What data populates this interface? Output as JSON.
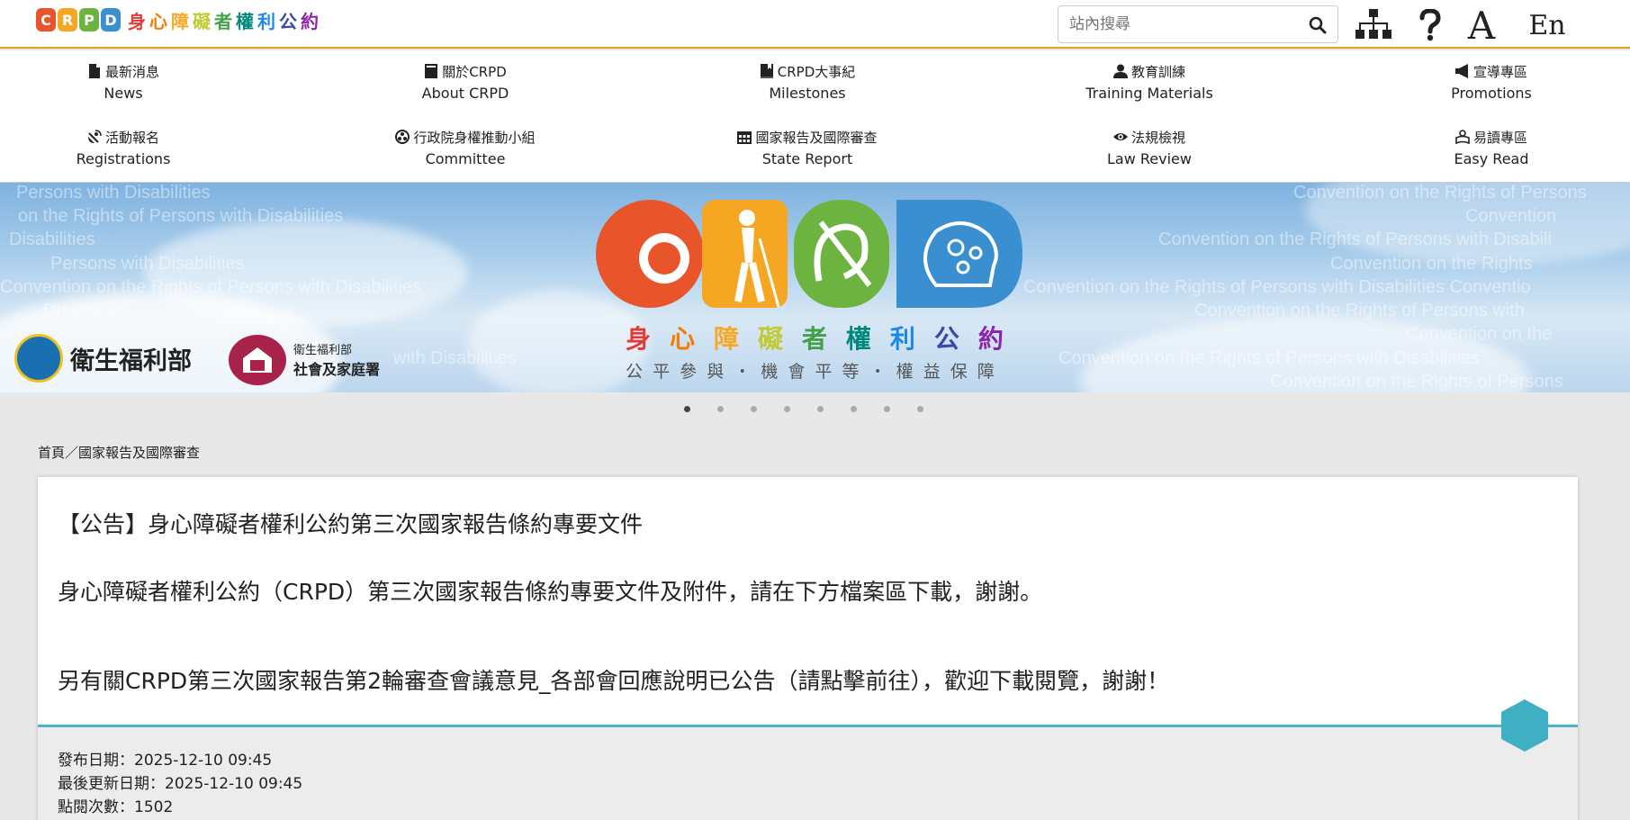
{
  "header": {
    "logo_text": [
      "身",
      "心",
      "障",
      "礙",
      "者",
      "權",
      "利",
      "公",
      "約"
    ],
    "logo_letters": [
      "C",
      "R",
      "P",
      "D"
    ],
    "search_placeholder": "站內搜尋",
    "lang_label": "En",
    "font_size_label": "A"
  },
  "nav": {
    "items": [
      {
        "zh": "最新消息",
        "en": "News",
        "icon": "document-icon"
      },
      {
        "zh": "關於CRPD",
        "en": "About CRPD",
        "icon": "folder-icon"
      },
      {
        "zh": "CRPD大事紀",
        "en": "Milestones",
        "icon": "bookmark-book-icon"
      },
      {
        "zh": "教育訓練",
        "en": "Training Materials",
        "icon": "user-icon"
      },
      {
        "zh": "宣導專區",
        "en": "Promotions",
        "icon": "megaphone-icon"
      },
      {
        "zh": "活動報名",
        "en": "Registrations",
        "icon": "satellite-dish-icon"
      },
      {
        "zh": "行政院身權推動小組",
        "en": "Committee",
        "icon": "group-icon"
      },
      {
        "zh": "國家報告及國際審查",
        "en": "State Report",
        "icon": "calendar-icon"
      },
      {
        "zh": "法規檢視",
        "en": "Law Review",
        "icon": "eye-icon"
      },
      {
        "zh": "易讀專區",
        "en": "Easy Read",
        "icon": "reader-icon"
      }
    ]
  },
  "banner": {
    "title_chars": [
      "身",
      "心",
      "障",
      "礙",
      "者",
      "權",
      "利",
      "公",
      "約"
    ],
    "subtitle_chars": [
      "公",
      "平",
      "參",
      "與",
      "・",
      "機",
      "會",
      "平",
      "等",
      "・",
      "權",
      "益",
      "保",
      "障"
    ],
    "mohw_name": "衛生福利部",
    "sfaa_line1": "衛生福利部",
    "sfaa_line2": "社會及家庭署",
    "bg_phrases": [
      "Convention on the Rights of Persons",
      "Convention",
      "Convention on the Rights of Persons with Disabili",
      "Convention on the Rights",
      "Convention on the Rights of Persons with Disabilities  Conventio",
      "Convention on the Rights of Persons with",
      "Convention on the",
      "Convention on the Rights of Persons with Disabilities",
      "Convention on the Rights of Persons",
      "Persons with Disabilities",
      "on the Rights of Persons with Disabilities",
      "Disabilities",
      "Persons with Disabilities",
      "Convention on the Rights of Persons with Disabilities",
      "Disabilities",
      "with Disabilities"
    ],
    "slide_count": 8,
    "active_slide": 0
  },
  "breadcrumb": "首頁／國家報告及國際審查",
  "article": {
    "title": "【公告】身心障礙者權利公約第三次國家報告條約專要文件",
    "paragraph1": "身心障礙者權利公約（CRPD）第三次國家報告條約專要文件及附件，請在下方檔案區下載，謝謝。",
    "paragraph2_link": "另有關CRPD第三次國家報告第2輪審查會議意見_各部會回應說明已公告（請點擊前往）",
    "paragraph2_tail": "，歡迎下載閱覽，謝謝！",
    "publish_date": "發布日期：2025-12-10 09:45",
    "updated_date": "最後更新日期：2025-12-10 09:45",
    "views": "點閱次數：1502"
  },
  "colors": {
    "header_border": "#d7a41a",
    "divider": "#4fb3c7",
    "hex_button": "#3fb0c4"
  }
}
